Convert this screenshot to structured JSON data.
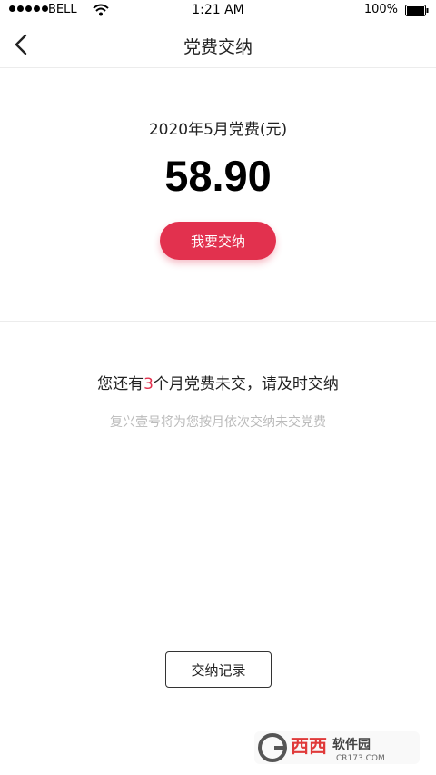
{
  "status_bar": {
    "carrier": "BELL",
    "time": "1:21 AM",
    "battery": "100%"
  },
  "nav": {
    "title": "党费交纳"
  },
  "fee": {
    "label": "2020年5月党费(元)",
    "amount": "58.90",
    "pay_button": "我要交纳"
  },
  "notice": {
    "prefix": "您还有",
    "count": "3",
    "suffix": "个月党费未交，请及时交纳",
    "sub": "复兴壹号将为您按月依次交纳未交党费"
  },
  "records_button": "交纳记录",
  "watermark": {
    "brand": "西西软件园",
    "url": "CR173.COM"
  },
  "colors": {
    "accent": "#e2314e"
  }
}
